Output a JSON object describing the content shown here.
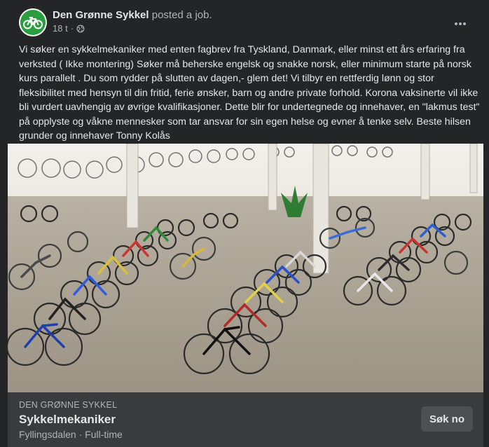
{
  "post": {
    "author": "Den Grønne Sykkel",
    "action": " posted a job.",
    "time": "18 t",
    "privacy_icon": "globe-icon",
    "more_icon": "more-dots-icon",
    "text": "Vi søker en sykkelmekaniker med enten fagbrev fra Tyskland, Danmark, eller minst ett års erfaring fra verksted ( Ikke montering) Søker må beherske engelsk og snakke norsk, eller minimum starte på norsk kurs parallelt . Du som rydder på slutten av dagen,- glem det! Vi tilbyr en rettferdig lønn og stor fleksibilitet med hensyn til din fritid, ferie ønsker, barn og andre private forhold. Korona vaksinerte vil ikke bli vurdert uavhengig av øvrige kvalifikasjoner. Dette blir for undertegnede og innehaver, en \"lakmus test\" på opplyste og våkne mennesker som tar ansvar for sin egen helse og evner å tenke selv. Beste hilsen grunder og innehaver Tonny Kolås"
  },
  "job": {
    "company": "DEN GRØNNE SYKKEL",
    "title": "Sykkelmekaniker",
    "location_type": "Fyllingsdalen · Full-time",
    "apply_label": "Søk no"
  },
  "colors": {
    "card_bg": "#242526",
    "job_bg": "#3a3b3c",
    "button_bg": "#4e4f50",
    "brand_green": "#2a9d3f"
  }
}
